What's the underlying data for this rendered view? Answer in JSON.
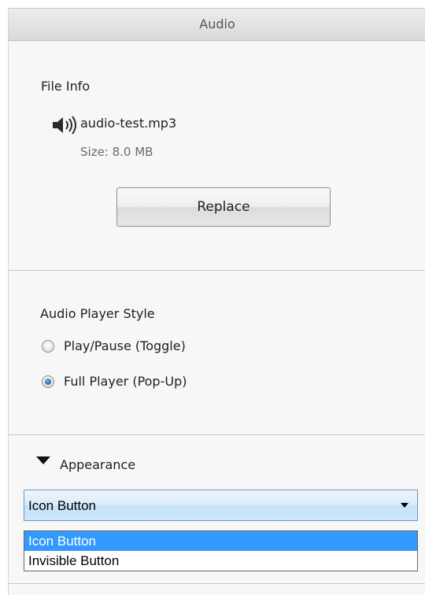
{
  "panel": {
    "title": "Audio"
  },
  "file_info": {
    "heading": "File Info",
    "icon": "speaker-icon",
    "filename": "audio-test.mp3",
    "size": "Size: 8.0 MB",
    "replace_label": "Replace"
  },
  "player_style": {
    "heading": "Audio Player Style",
    "options": [
      {
        "label": "Play/Pause (Toggle)",
        "checked": false
      },
      {
        "label": "Full Player (Pop-Up)",
        "checked": true
      }
    ]
  },
  "appearance": {
    "heading": "Appearance",
    "selected": "Icon Button",
    "options": [
      "Icon Button",
      "Invisible Button"
    ],
    "highlight_color": "#3399ff"
  }
}
